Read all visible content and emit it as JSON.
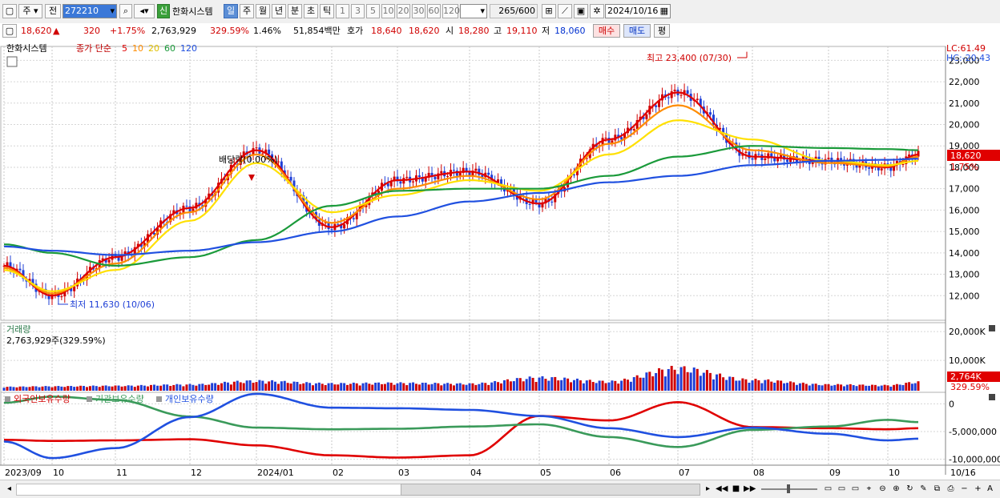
{
  "toolbar": {
    "market_label": "주",
    "prev_label": "전",
    "code_value": "272210",
    "market_badge": "신",
    "stock_name": "한화시스템",
    "period_day": "일",
    "period_week": "주",
    "period_month": "월",
    "period_year": "년",
    "period_minute": "분",
    "period_second": "초",
    "period_tick": "틱",
    "interval_buttons": [
      "1",
      "3",
      "5",
      "10",
      "20",
      "30",
      "60",
      "120"
    ],
    "count_value": "265",
    "count_total": "/600",
    "date_value": "2024/10/16"
  },
  "quote": {
    "price": "18,620",
    "direction": "▲",
    "change": "320",
    "change_pct": "+1.75%",
    "volume": "2,763,929",
    "volume_pct": "329.59%",
    "turnover_pct": "1.46%",
    "amount": "51,854백만",
    "hoga_label": "호가",
    "hoga_ask": "18,640",
    "hoga_bid": "18,620",
    "open_label": "시",
    "open": "18,280",
    "high_label": "고",
    "high": "19,110",
    "low_label": "저",
    "low": "18,060",
    "buy_label": "매수",
    "sell_label": "매도",
    "eval_label": "평"
  },
  "price_panel": {
    "stock_label": "한화시스템",
    "ma_label": "종가 단순",
    "ma_periods": [
      "5",
      "10",
      "20",
      "60",
      "120"
    ],
    "lc": "LC:61.49",
    "hc": "HC:-20.43",
    "high_note": "최고 23,400 (07/30)",
    "low_note": "최저 11,630 (10/06)",
    "dividend_note": "배당락(0.00%)",
    "last_price_tag": "18,620",
    "last_pct_tag": "1.75%"
  },
  "volume_panel": {
    "title": "거래량",
    "info": "2,763,929주(329.59%)",
    "last_tag": "2,764K",
    "last_pct_tag": "329.59%"
  },
  "holding_panel": {
    "foreign_label": "외국인보유수량",
    "inst_label": "기관보유수량",
    "indiv_label": "개인보유수량"
  },
  "x_axis": {
    "labels": [
      "2023/09",
      "10",
      "11",
      "12",
      "2024/01",
      "02",
      "03",
      "04",
      "05",
      "06",
      "07",
      "08",
      "09",
      "10"
    ],
    "end_label": "10/16"
  },
  "colors": {
    "up": "#d00000",
    "down": "#1f3fd6",
    "ma5": "#e00000",
    "ma10": "#ff8c00",
    "ma20": "#ffe000",
    "ma60": "#1a9a3a",
    "ma120": "#2050e0",
    "foreign": "#e00000",
    "institution": "#3a9a5a",
    "individual": "#2050e0"
  },
  "chart_data": [
    {
      "type": "line",
      "title": "한화시스템",
      "x": [
        "2023/09",
        "10",
        "11",
        "12",
        "2024/01",
        "02",
        "03",
        "04",
        "05",
        "06",
        "07",
        "08",
        "09",
        "10",
        "10/16"
      ],
      "ylim": [
        11000,
        23500
      ],
      "y_ticks": [
        "12,000",
        "13,000",
        "14,000",
        "15,000",
        "16,000",
        "17,000",
        "18,000",
        "19,000",
        "20,000",
        "21,000",
        "22,000",
        "23,000"
      ],
      "series": [
        {
          "name": "종가 단순 5",
          "values": [
            13400,
            12000,
            13800,
            16100,
            18800,
            15200,
            17400,
            17800,
            16300,
            19300,
            21500,
            18500,
            18300,
            18000,
            18600
          ]
        },
        {
          "name": "10",
          "values": [
            13300,
            12100,
            13500,
            15900,
            18600,
            15400,
            17000,
            17600,
            16500,
            19100,
            20900,
            18800,
            18200,
            18050,
            18500
          ]
        },
        {
          "name": "20",
          "values": [
            13200,
            12200,
            13200,
            15500,
            18200,
            15900,
            16700,
            17400,
            16900,
            18600,
            20200,
            19300,
            18300,
            18100,
            18300
          ]
        },
        {
          "name": "60",
          "values": [
            14400,
            14000,
            13400,
            13800,
            14600,
            16200,
            16900,
            17000,
            17000,
            17600,
            18500,
            19000,
            18900,
            18850,
            18800
          ]
        },
        {
          "name": "120",
          "values": [
            14300,
            14100,
            13900,
            14100,
            14500,
            15000,
            15700,
            16400,
            16800,
            17300,
            17600,
            18100,
            18300,
            18350,
            18400
          ]
        }
      ],
      "annotations": [
        "최고 23,400 (07/30)",
        "최저 11,630 (10/06)",
        "배당락(0.00%)"
      ]
    },
    {
      "type": "bar",
      "title": "거래량",
      "y_ticks": [
        "10,000K",
        "20,000K"
      ],
      "ylim": [
        0,
        22000
      ],
      "x": [
        "2023/09",
        "10",
        "11",
        "12",
        "2024/01",
        "02",
        "03",
        "04",
        "05",
        "06",
        "07",
        "08",
        "09",
        "10",
        "10/16"
      ],
      "values": [
        900,
        1100,
        1300,
        1800,
        3200,
        2200,
        2400,
        2100,
        4500,
        3000,
        8200,
        3600,
        1800,
        1500,
        2764
      ]
    },
    {
      "type": "line",
      "title": "보유수량",
      "y_ticks": [
        "0",
        "-5,000,000",
        "-10,000,000"
      ],
      "ylim": [
        -10500000,
        1500000
      ],
      "x": [
        "2023/09",
        "10",
        "11",
        "12",
        "2024/01",
        "02",
        "03",
        "04",
        "05",
        "06",
        "07",
        "08",
        "09",
        "10",
        "10/16"
      ],
      "series": [
        {
          "name": "외국인보유수량",
          "values": [
            -6500000,
            -6700000,
            -6600000,
            -6400000,
            -7500000,
            -9300000,
            -9700000,
            -9300000,
            -2200000,
            -3000000,
            300000,
            -4200000,
            -4400000,
            -4600000,
            -4400000
          ]
        },
        {
          "name": "기관보유수량",
          "values": [
            200000,
            1300000,
            700000,
            -2300000,
            -4300000,
            -4600000,
            -4500000,
            -4100000,
            -3700000,
            -6000000,
            -7800000,
            -4700000,
            -4100000,
            -2900000,
            -3300000
          ]
        },
        {
          "name": "개인보유수량",
          "values": [
            -6800000,
            -9800000,
            -8000000,
            -2400000,
            1800000,
            -700000,
            -800000,
            -1100000,
            -2200000,
            -4400000,
            -6000000,
            -4300000,
            -5400000,
            -6600000,
            -6300000
          ]
        }
      ]
    }
  ]
}
